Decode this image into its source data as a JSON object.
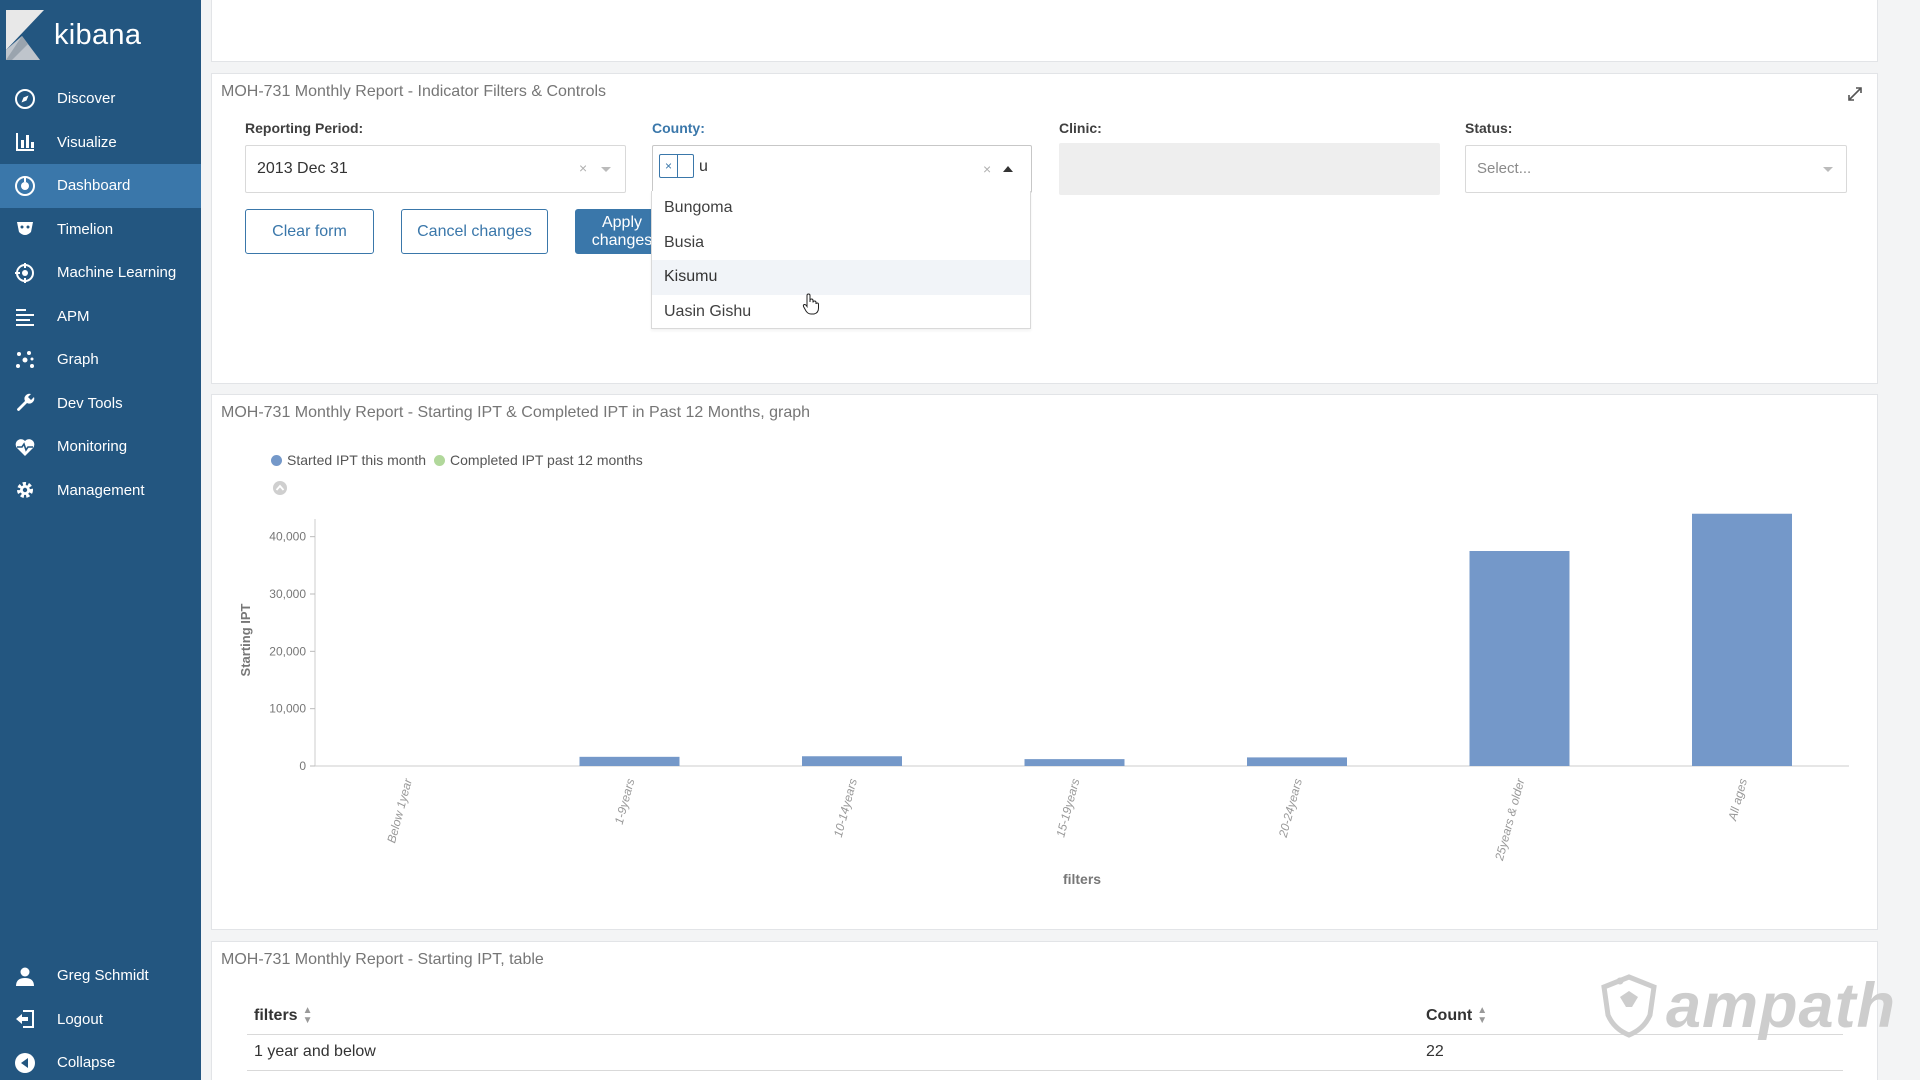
{
  "app": {
    "brand": "kibana"
  },
  "sidebar": {
    "items": [
      {
        "label": "Discover",
        "icon": "compass-icon",
        "active": false
      },
      {
        "label": "Visualize",
        "icon": "bar-chart-icon",
        "active": false
      },
      {
        "label": "Dashboard",
        "icon": "dashboard-icon",
        "active": true
      },
      {
        "label": "Timelion",
        "icon": "timelion-icon",
        "active": false
      },
      {
        "label": "Machine Learning",
        "icon": "machine-learning-icon",
        "active": false
      },
      {
        "label": "APM",
        "icon": "apm-icon",
        "active": false
      },
      {
        "label": "Graph",
        "icon": "graph-icon",
        "active": false
      },
      {
        "label": "Dev Tools",
        "icon": "wrench-icon",
        "active": false
      },
      {
        "label": "Monitoring",
        "icon": "heartbeat-icon",
        "active": false
      },
      {
        "label": "Management",
        "icon": "gear-icon",
        "active": false
      }
    ],
    "bottom": [
      {
        "label": "Greg Schmidt",
        "icon": "user-icon"
      },
      {
        "label": "Logout",
        "icon": "logout-icon"
      },
      {
        "label": "Collapse",
        "icon": "collapse-icon"
      }
    ]
  },
  "controls_panel": {
    "title": "MOH-731 Monthly Report - Indicator Filters & Controls",
    "reporting_period": {
      "label": "Reporting Period:",
      "value": "2013 Dec 31"
    },
    "county": {
      "label": "County:",
      "input_value": "u",
      "options": [
        "Bungoma",
        "Busia",
        "Kisumu",
        "Uasin Gishu"
      ],
      "hovered": "Kisumu"
    },
    "clinic": {
      "label": "Clinic:"
    },
    "status": {
      "label": "Status:",
      "placeholder": "Select..."
    },
    "buttons": {
      "clear": "Clear form",
      "cancel": "Cancel changes",
      "apply": "Apply changes"
    }
  },
  "chart_panel": {
    "title": "MOH-731 Monthly Report - Starting IPT & Completed IPT in Past 12 Months, graph"
  },
  "chart_data": {
    "type": "bar",
    "categories": [
      "Below 1year",
      "1-9years",
      "10-14years",
      "15-19years",
      "20-24years",
      "25years & older",
      "All ages"
    ],
    "series": [
      {
        "name": "Started IPT this month",
        "color": "#7498c9",
        "values": [
          0,
          1600,
          1700,
          1200,
          1500,
          37500,
          44000
        ]
      },
      {
        "name": "Completed IPT past 12 months",
        "color": "#b1d89b",
        "values": [
          0,
          0,
          0,
          0,
          0,
          0,
          0
        ]
      }
    ],
    "yticks": [
      "0",
      "10,000",
      "20,000",
      "30,000",
      "40,000"
    ],
    "ylim": [
      0,
      45000
    ],
    "ylabel": "Starting IPT",
    "xlabel": "filters",
    "legend": "top-left"
  },
  "table_panel": {
    "title": "MOH-731 Monthly Report - Starting IPT, table",
    "columns": [
      "filters",
      "Count"
    ],
    "rows": [
      [
        "1 year and below",
        "22"
      ]
    ]
  },
  "watermark": "ampath"
}
